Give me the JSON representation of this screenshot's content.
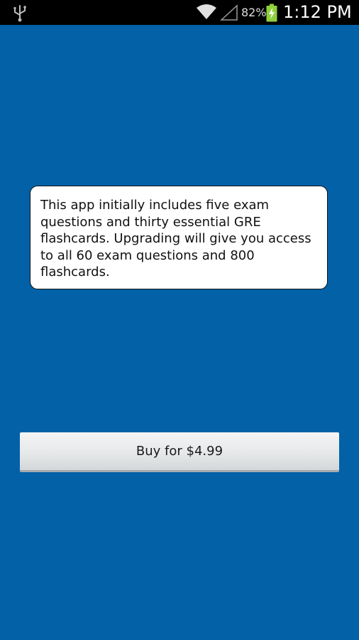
{
  "status_bar": {
    "battery_percent": "82%",
    "time": "1:12 PM",
    "icons": [
      "usb-icon",
      "wifi-icon",
      "signal-icon",
      "battery-charging-icon"
    ]
  },
  "info_card": {
    "text": "This app initially includes five exam questions and thirty essential GRE flashcards. Upgrading will give you access to all 60 exam questions and 800 flashcards."
  },
  "buy_button": {
    "label": "Buy for $4.99"
  },
  "colors": {
    "background": "#0361a8",
    "status_bar": "#000000",
    "battery_charging": "#8fd13b"
  }
}
